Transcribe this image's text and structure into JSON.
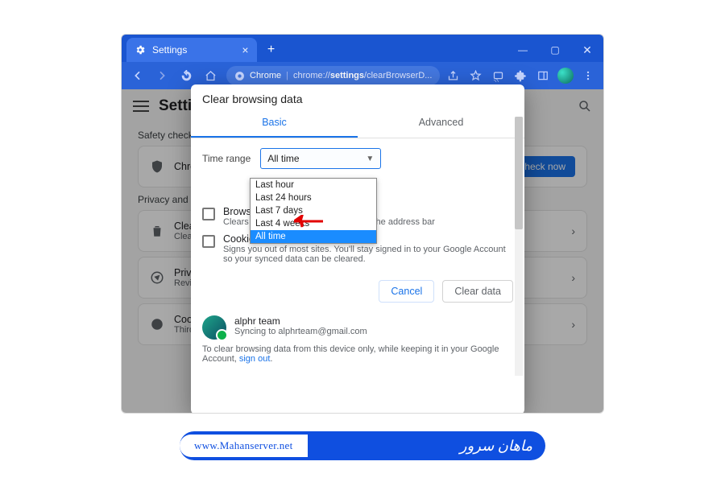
{
  "window": {
    "tab_title": "Settings",
    "controls": {
      "minimize": "—",
      "maximize": "▢",
      "close": "✕"
    }
  },
  "nav": {
    "chrome_label": "Chrome",
    "url_prefix": "chrome://",
    "url_bold": "settings",
    "url_rest": "/clearBrowserD..."
  },
  "page": {
    "title": "Settings",
    "safety_label": "Safety check",
    "check_card": {
      "title": "Chrome...",
      "button": "Check now"
    },
    "privacy_label": "Privacy and security",
    "cards": [
      {
        "title": "Clear browsing data",
        "sub": "Clear history, cookies, cache, and more"
      },
      {
        "title": "Privacy Guide",
        "sub": "Review key privacy and security controls"
      },
      {
        "title": "Cookies and other site data",
        "sub": "Third-party cookies are blocked in Incognito mode"
      }
    ]
  },
  "dialog": {
    "title": "Clear browsing data",
    "tabs": {
      "basic": "Basic",
      "advanced": "Advanced"
    },
    "time_label": "Time range",
    "select_value": "All time",
    "options": [
      "Last hour",
      "Last 24 hours",
      "Last 7 days",
      "Last 4 weeks",
      "All time"
    ],
    "rows": [
      {
        "title": "Browsing history",
        "sub": "Clears history and autocompletions in the address bar"
      },
      {
        "title": "Cookies and other site data",
        "sub": "Signs you out of most sites. You'll stay signed in to your Google Account so your synced data can be cleared."
      }
    ],
    "buttons": {
      "cancel": "Cancel",
      "clear": "Clear data"
    },
    "user": {
      "name": "alphr team",
      "sync": "Syncing to alphrteam@gmail.com"
    },
    "note_pre": "To clear browsing data from this device only, while keeping it in your Google Account, ",
    "note_link": "sign out",
    "note_post": "."
  },
  "banner": {
    "url": "www.Mahanserver.net",
    "logo": "ماهان سرور"
  }
}
